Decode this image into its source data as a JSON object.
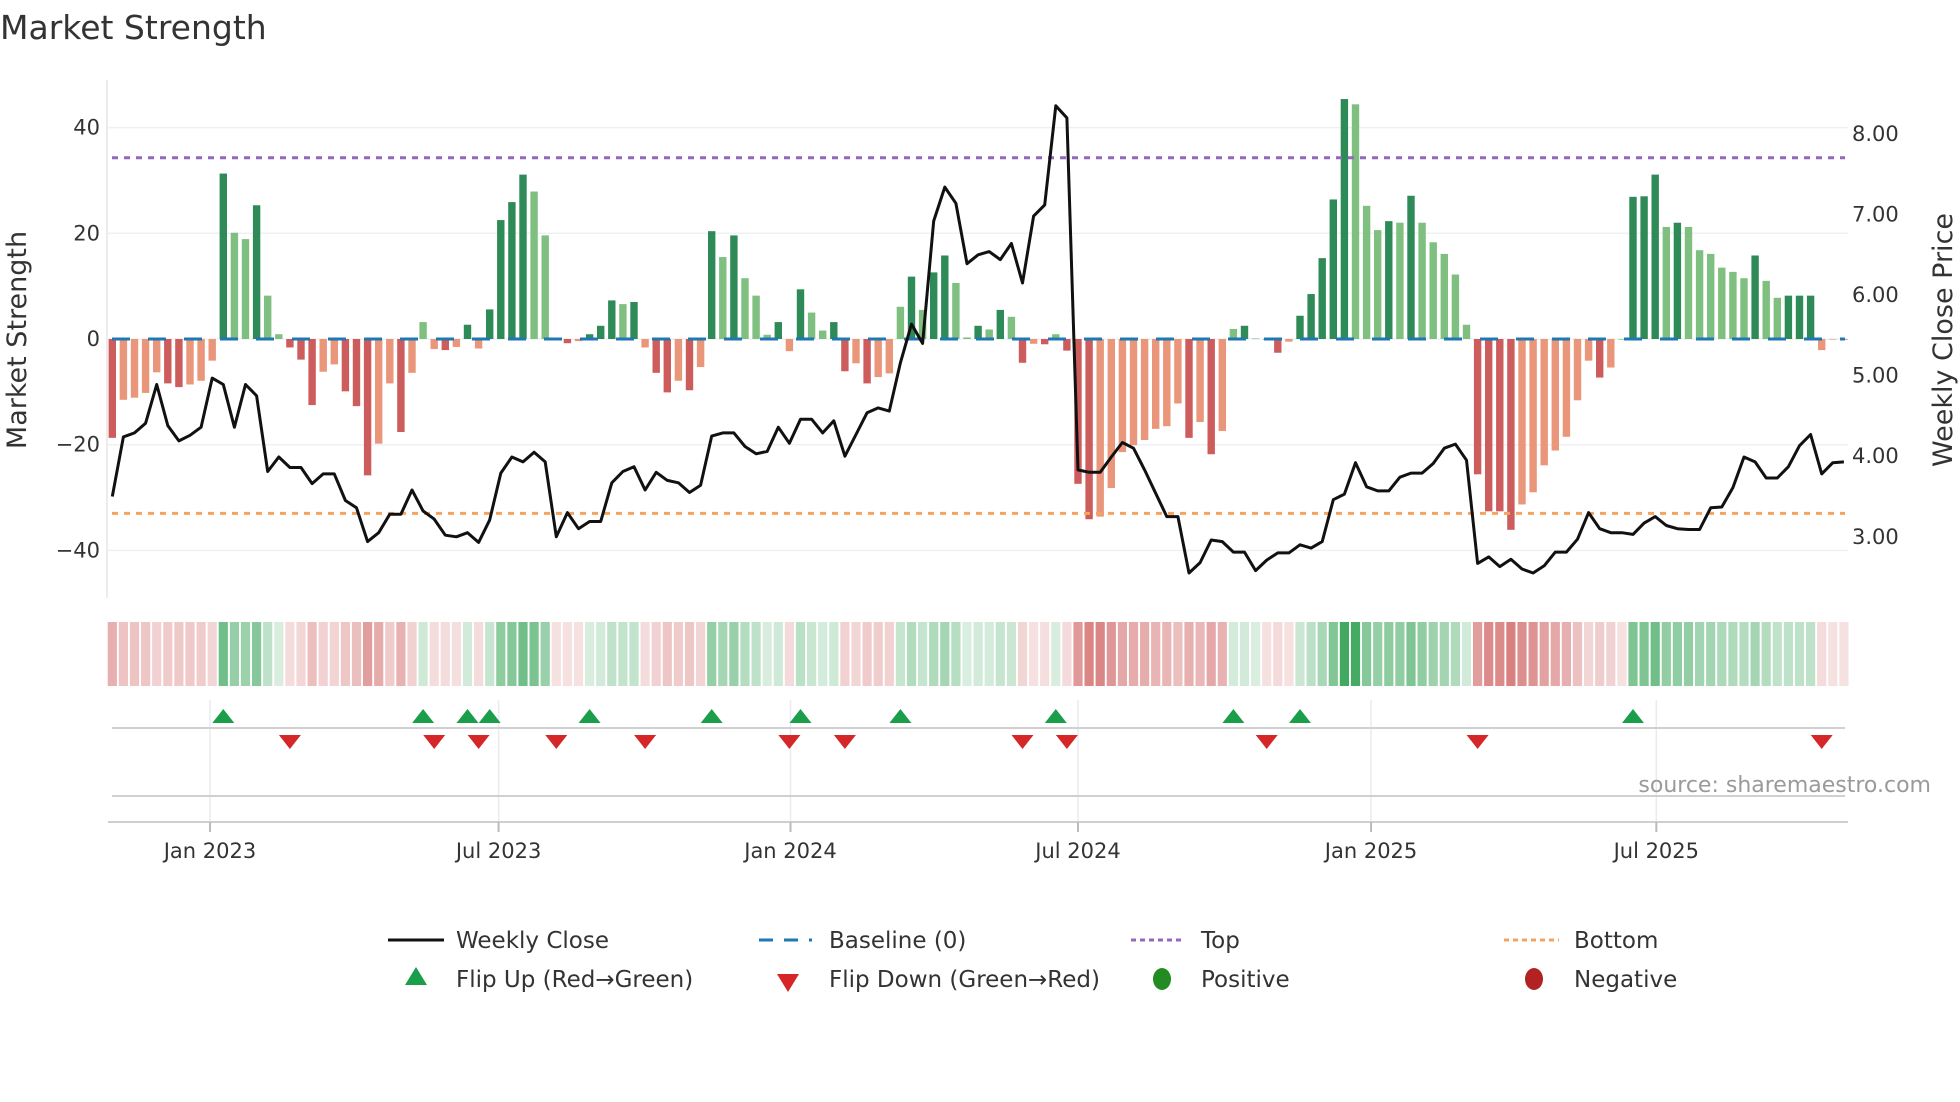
{
  "chart_data": {
    "type": "bar",
    "title": "Market Strength",
    "ylabel": "Market Strength",
    "y2label": "Weekly Close Price",
    "ylim": [
      -49,
      49
    ],
    "y2lim": [
      2.24,
      8.67
    ],
    "y_ticks": [
      "40",
      "20",
      "0",
      "−20",
      "−40"
    ],
    "y_tick_values": [
      40,
      20,
      0,
      -20,
      -40
    ],
    "y2_ticks": [
      "8.00",
      "7.00",
      "6.00",
      "5.00",
      "4.00",
      "3.00"
    ],
    "y2_tick_values": [
      8,
      7,
      6,
      5,
      4,
      3
    ],
    "x_ticks": [
      {
        "label": "Jan 2023",
        "week": 9.8
      },
      {
        "label": "Jul 2023",
        "week": 35.8
      },
      {
        "label": "Jan 2024",
        "week": 62.1
      },
      {
        "label": "Jul 2024",
        "week": 88.0
      },
      {
        "label": "Jan 2025",
        "week": 114.4
      },
      {
        "label": "Jul 2025",
        "week": 140.1
      }
    ],
    "top_level": 34.3,
    "bottom_level": -33.0,
    "strength": [
      -18.7,
      -11.5,
      -11.1,
      -10.2,
      -6.3,
      -8.4,
      -9.1,
      -8.6,
      -7.9,
      -4.1,
      31.3,
      20.1,
      18.9,
      25.3,
      8.2,
      0.9,
      -1.6,
      -3.9,
      -12.5,
      -6.2,
      -4.8,
      -9.9,
      -12.7,
      -25.8,
      -19.8,
      -8.4,
      -17.6,
      -6.4,
      3.2,
      -1.9,
      -2.1,
      -1.5,
      2.7,
      -1.8,
      5.6,
      22.5,
      25.9,
      31.1,
      27.9,
      19.6,
      -0.1,
      -0.8,
      -0.4,
      0.9,
      2.5,
      7.3,
      6.6,
      7.0,
      -1.6,
      -6.4,
      -10.1,
      -7.9,
      -9.7,
      -5.3,
      20.4,
      15.5,
      19.6,
      11.5,
      8.2,
      0.8,
      3.2,
      -2.3,
      9.4,
      5.0,
      1.6,
      3.2,
      -6.1,
      -4.6,
      -8.4,
      -7.2,
      -6.5,
      6.1,
      11.8,
      5.5,
      12.6,
      15.8,
      10.6,
      0.3,
      2.5,
      1.8,
      5.5,
      4.2,
      -4.5,
      -0.9,
      -1.0,
      0.9,
      -2.2,
      -27.4,
      -34.1,
      -33.6,
      -28.2,
      -21.4,
      -20.1,
      -19.1,
      -17.0,
      -16.5,
      -12.2,
      -18.7,
      -15.7,
      -21.8,
      -17.4,
      1.9,
      2.5,
      0.1,
      -0.1,
      -2.6,
      -0.5,
      4.4,
      8.5,
      15.3,
      26.4,
      45.4,
      44.4,
      25.2,
      20.6,
      22.3,
      22.0,
      27.1,
      22.0,
      18.3,
      16.1,
      12.2,
      2.7,
      -25.6,
      -32.6,
      -32.6,
      -36.1,
      -31.3,
      -29.0,
      -23.9,
      -21.1,
      -18.5,
      -11.6,
      -4.1,
      -7.3,
      -5.4,
      0.0,
      26.9,
      27.0,
      31.1,
      21.2,
      22.0,
      21.2,
      16.8,
      16.1,
      13.5,
      12.7,
      11.5,
      15.8,
      11.0,
      7.8,
      8.2,
      8.2,
      8.2,
      -2.1,
      -0.1,
      -0.1
    ],
    "weekly_close": [
      3.5,
      4.24,
      4.29,
      4.41,
      4.89,
      4.38,
      4.19,
      4.26,
      4.36,
      4.97,
      4.89,
      4.36,
      4.89,
      4.75,
      3.81,
      3.99,
      3.86,
      3.86,
      3.66,
      3.78,
      3.78,
      3.45,
      3.36,
      2.94,
      3.05,
      3.28,
      3.28,
      3.58,
      3.32,
      3.22,
      3.02,
      3.0,
      3.05,
      2.93,
      3.21,
      3.79,
      3.99,
      3.93,
      4.05,
      3.93,
      3.0,
      3.3,
      3.1,
      3.19,
      3.19,
      3.67,
      3.81,
      3.87,
      3.58,
      3.8,
      3.7,
      3.67,
      3.55,
      3.64,
      4.25,
      4.29,
      4.29,
      4.12,
      4.03,
      4.06,
      4.36,
      4.16,
      4.46,
      4.46,
      4.29,
      4.44,
      4.0,
      4.27,
      4.54,
      4.6,
      4.56,
      5.16,
      5.64,
      5.4,
      6.92,
      7.34,
      7.14,
      6.39,
      6.5,
      6.54,
      6.44,
      6.64,
      6.15,
      6.98,
      7.12,
      8.35,
      8.2,
      3.83,
      3.8,
      3.8,
      3.99,
      4.17,
      4.1,
      3.83,
      3.54,
      3.25,
      3.25,
      2.55,
      2.68,
      2.96,
      2.94,
      2.81,
      2.81,
      2.58,
      2.71,
      2.8,
      2.8,
      2.9,
      2.86,
      2.94,
      3.46,
      3.53,
      3.92,
      3.62,
      3.57,
      3.57,
      3.74,
      3.79,
      3.79,
      3.91,
      4.1,
      4.15,
      3.95,
      2.67,
      2.75,
      2.63,
      2.72,
      2.6,
      2.55,
      2.64,
      2.81,
      2.81,
      2.97,
      3.3,
      3.1,
      3.05,
      3.05,
      3.03,
      3.17,
      3.25,
      3.14,
      3.1,
      3.09,
      3.09,
      3.36,
      3.37,
      3.61,
      3.99,
      3.93,
      3.73,
      3.73,
      3.87,
      4.13,
      4.27,
      3.78,
      3.92,
      3.93
    ],
    "flip_up_weeks": [
      11,
      29,
      33,
      35,
      44,
      55,
      63,
      72,
      86,
      102,
      108,
      138
    ],
    "flip_down_weeks": [
      17,
      30,
      34,
      41,
      49,
      62,
      67,
      83,
      87,
      105,
      124,
      155
    ],
    "legend_placement": "bottom",
    "grid": true
  },
  "colors": {
    "pos_strong": "#2e8b57",
    "pos_weak": "#7fbf7f",
    "neg_strong": "#cd5c5c",
    "neg_weak": "#e9967a",
    "baseline": "#1f77b4",
    "top": "#9467bd",
    "bottom": "#f4a460",
    "flip_up": "#1a9e4a",
    "flip_down": "#d62728",
    "positive": "#228b22",
    "negative": "#b22222",
    "close": "#111111"
  },
  "legend": {
    "weekly_close": "Weekly Close",
    "baseline": "Baseline (0)",
    "top": "Top",
    "bottom": "Bottom",
    "flip_up": "Flip Up (Red→Green)",
    "flip_down": "Flip Down (Green→Red)",
    "positive": "Positive",
    "negative": "Negative"
  },
  "source": "source: sharemaestro.com"
}
